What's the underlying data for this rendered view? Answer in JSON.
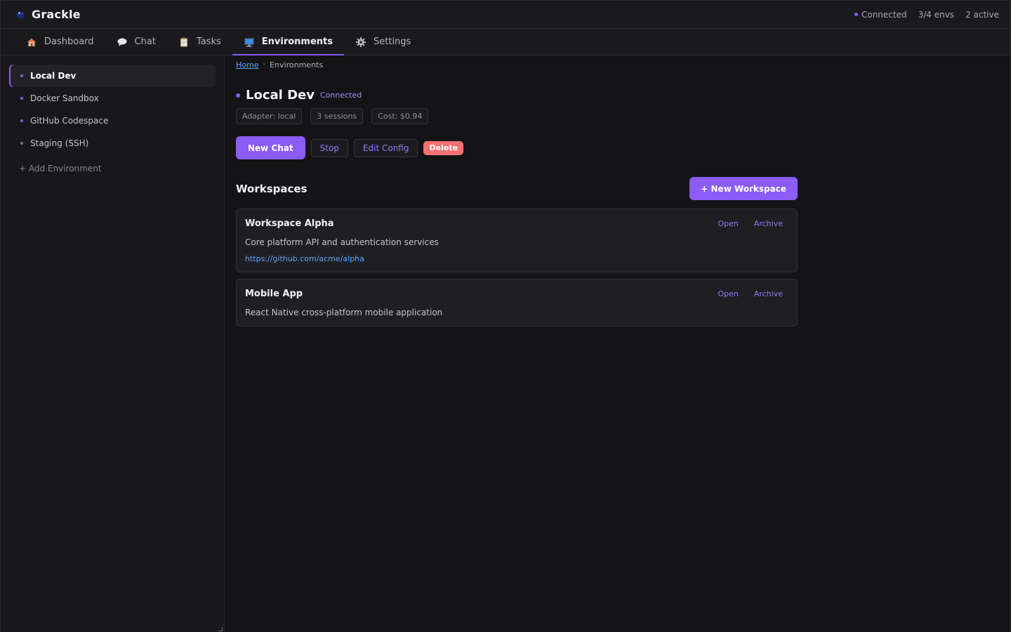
{
  "app": {
    "name": "Grackle",
    "status": {
      "connection": "Connected",
      "envs": "3/4 envs",
      "active": "2 active"
    }
  },
  "tabs": [
    {
      "label": "Dashboard",
      "icon": "house-icon"
    },
    {
      "label": "Chat",
      "icon": "speech-bubble-icon"
    },
    {
      "label": "Tasks",
      "icon": "clipboard-icon"
    },
    {
      "label": "Environments",
      "icon": "computer-icon",
      "active": true
    },
    {
      "label": "Settings",
      "icon": "gear-icon"
    }
  ],
  "sidebar": {
    "items": [
      {
        "label": "Local Dev",
        "active": true
      },
      {
        "label": "Docker Sandbox"
      },
      {
        "label": "GitHub Codespace"
      },
      {
        "label": "Staging (SSH)"
      }
    ],
    "add_label": "+ Add Environment"
  },
  "breadcrumb": {
    "home": "Home",
    "sep": "›",
    "current": "Environments"
  },
  "environment": {
    "name": "Local Dev",
    "status": "Connected",
    "meta": [
      "Adapter: local",
      "3 sessions",
      "Cost: $0.94"
    ],
    "actions": {
      "new_chat": "New Chat",
      "stop": "Stop",
      "edit": "Edit Config",
      "delete": "Delete"
    }
  },
  "workspaces": {
    "title": "Workspaces",
    "new_label": "+ New Workspace",
    "items": [
      {
        "name": "Workspace Alpha",
        "description": "Core platform API and authentication services",
        "url": "https://github.com/acme/alpha",
        "open": "Open",
        "archive": "Archive"
      },
      {
        "name": "Mobile App",
        "description": "React Native cross-platform mobile application",
        "open": "Open",
        "archive": "Archive"
      }
    ]
  },
  "colors": {
    "accent": "#8b5cf6",
    "danger": "#f87171",
    "link": "#60a5fa"
  }
}
